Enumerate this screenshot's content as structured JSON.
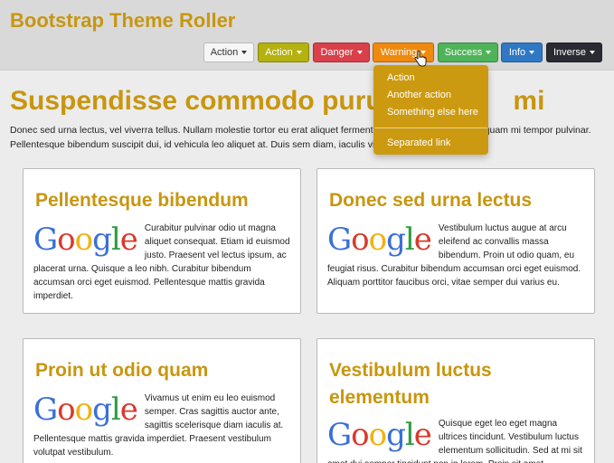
{
  "app": {
    "title": "Bootstrap Theme Roller"
  },
  "buttons": {
    "action1": "Action",
    "action2": "Action",
    "danger": "Danger",
    "warning": "Warning",
    "success": "Success",
    "info": "Info",
    "inverse": "Inverse"
  },
  "dropdown": {
    "items": [
      "Action",
      "Another action",
      "Something else here"
    ],
    "separated": "Separated link"
  },
  "hero": {
    "title": "Suspendisse commodo purus",
    "title_tail": "mi",
    "text": "Donec sed urna lectus, vel viverra tellus. Nullam molestie tortor eu erat aliquet fermentum. Suspendisse purus aliquam mi tempor pulvinar. Pellentesque bibendum suscipit dui, id vehicula leo aliquet at. Duis sem diam, iaculis vitae leo."
  },
  "cards": [
    {
      "title": "Pellentesque bibendum",
      "text": "Curabitur pulvinar odio ut magna aliquet consequat. Etiam id euismod justo. Praesent vel lectus ipsum, ac placerat urna. Quisque a leo nibh. Curabitur bibendum accumsan orci eget euismod. Pellentesque mattis gravida imperdiet."
    },
    {
      "title": "Donec sed urna lectus",
      "text": "Vestibulum luctus augue at arcu eleifend ac convallis massa bibendum. Proin ut odio quam, eu feugiat risus. Curabitur bibendum accumsan orci eget euismod. Aliquam porttitor faucibus orci, vitae semper dui varius eu."
    },
    {
      "title": "Proin ut odio quam",
      "text": "Vivamus ut enim eu leo euismod semper. Cras sagittis auctor ante, sagittis scelerisque diam iaculis at. Pellentesque mattis gravida imperdiet. Praesent vestibulum volutpat vestibulum."
    },
    {
      "title": "Vestibulum luctus elementum",
      "text": "Quisque eget leo eget magna ultrices tincidunt. Vestibulum luctus elementum sollicitudin. Sed at mi sit amet dui semper tincidunt non in lorem. Proin sit amet."
    }
  ],
  "logo": {
    "letters": [
      "G",
      "o",
      "o",
      "g",
      "l",
      "e"
    ]
  },
  "colors": {
    "accent": "#c8960f",
    "danger": "#d9404a",
    "warning": "#f08a0e",
    "success": "#4fb35a",
    "info": "#2f78c4",
    "inverse": "#2a2a32"
  }
}
